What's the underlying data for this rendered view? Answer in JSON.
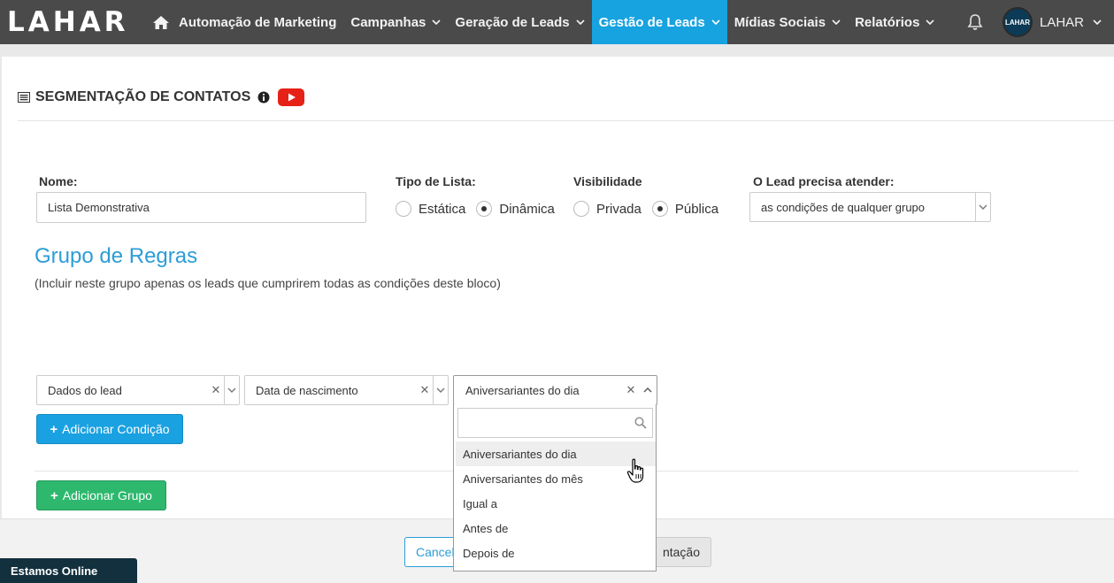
{
  "navbar": {
    "logo": "LAHAR",
    "menu": [
      {
        "label": "Automação de Marketing",
        "has_caret": false
      },
      {
        "label": "Campanhas",
        "has_caret": true
      },
      {
        "label": "Geração de Leads",
        "has_caret": true
      },
      {
        "label": "Gestão de Leads",
        "has_caret": true,
        "active": true
      },
      {
        "label": "Mídias Sociais",
        "has_caret": true
      },
      {
        "label": "Relatórios",
        "has_caret": true
      }
    ],
    "user_avatar_text": "LAHAR",
    "user_name": "LAHAR"
  },
  "page": {
    "title": "SEGMENTAÇÃO DE CONTATOS"
  },
  "form": {
    "name_label": "Nome:",
    "name_value": "Lista Demonstrativa",
    "list_type_label": "Tipo de Lista:",
    "list_type_options": [
      "Estática",
      "Dinâmica"
    ],
    "list_type_selected": "Dinâmica",
    "visibility_label": "Visibilidade",
    "visibility_options": [
      "Privada",
      "Pública"
    ],
    "visibility_selected": "Pública",
    "match_label": "O Lead precisa atender:",
    "match_value": "as condições de qualquer grupo"
  },
  "rules_group": {
    "title": "Grupo de Regras",
    "subtitle": "(Incluir neste grupo apenas os leads que cumprirem todas as condições deste bloco)",
    "condition": {
      "field_group": "Dados do lead",
      "field": "Data de nascimento",
      "operator": "Aniversariantes do dia"
    },
    "add_condition_label": "Adicionar Condição",
    "add_group_label": "Adicionar Grupo"
  },
  "dropdown": {
    "options": [
      "Aniversariantes do dia",
      "Aniversariantes do mês",
      "Igual a",
      "Antes de",
      "Depois de"
    ],
    "hovered": "Aniversariantes do dia"
  },
  "footer": {
    "cancel_label": "Cancel",
    "save_label": "ntação"
  },
  "chat": {
    "label": "Estamos Online"
  },
  "colors": {
    "navbar_bg": "#4a4a4a",
    "active_tab": "#17a2e0",
    "primary_blue": "#1aa1e1",
    "success_green": "#2db86e",
    "title_blue": "#2c9dd6",
    "youtube_red": "#e62117",
    "chat_bg": "#12303d"
  }
}
